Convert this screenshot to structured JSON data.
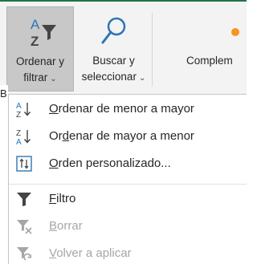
{
  "ribbon": {
    "sort_filter": {
      "label_line1": "Ordenar y",
      "label_line2": "filtrar",
      "icon": "sort-filter-icon"
    },
    "find_select": {
      "label_line1": "Buscar y",
      "label_line2": "seleccionar",
      "icon": "magnifier-icon"
    },
    "complements": {
      "label": "Complem",
      "icon": "addins-icon"
    },
    "accent_color": "#217346"
  },
  "edge_text": "B",
  "menu": {
    "items": [
      {
        "key": "O",
        "rest": "rdenar de menor a mayor",
        "icon": "sort-ascending-icon",
        "enabled": true
      },
      {
        "pre": "Or",
        "key": "d",
        "rest": "enar de mayor a menor",
        "icon": "sort-descending-icon",
        "enabled": true
      },
      {
        "key": "O",
        "rest": "rden personalizado...",
        "icon": "custom-sort-icon",
        "enabled": true
      },
      {
        "key": "F",
        "rest": "iltro",
        "icon": "filter-icon",
        "enabled": true
      },
      {
        "key": "B",
        "rest": "orrar",
        "icon": "clear-filter-icon",
        "enabled": false
      },
      {
        "key": "V",
        "rest": "olver a aplicar",
        "icon": "reapply-filter-icon",
        "enabled": false
      }
    ]
  }
}
